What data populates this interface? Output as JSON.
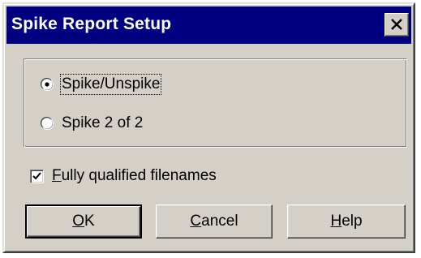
{
  "window": {
    "title": "Spike Report Setup",
    "close_icon": "close-icon"
  },
  "options_group": {
    "radios": [
      {
        "label": "Spike/Unspike",
        "selected": true
      },
      {
        "label": "Spike 2 of 2",
        "selected": false
      }
    ]
  },
  "fully_qualified": {
    "mnemonic": "F",
    "label_rest": "ully qualified filenames",
    "checked": true
  },
  "buttons": {
    "ok": {
      "mnemonic": "O",
      "rest": "K"
    },
    "cancel": {
      "mnemonic": "C",
      "rest": "ancel"
    },
    "help": {
      "mnemonic": "H",
      "rest": "elp"
    }
  },
  "colors": {
    "titlebar": "#000080",
    "face": "#d4d0c8"
  }
}
